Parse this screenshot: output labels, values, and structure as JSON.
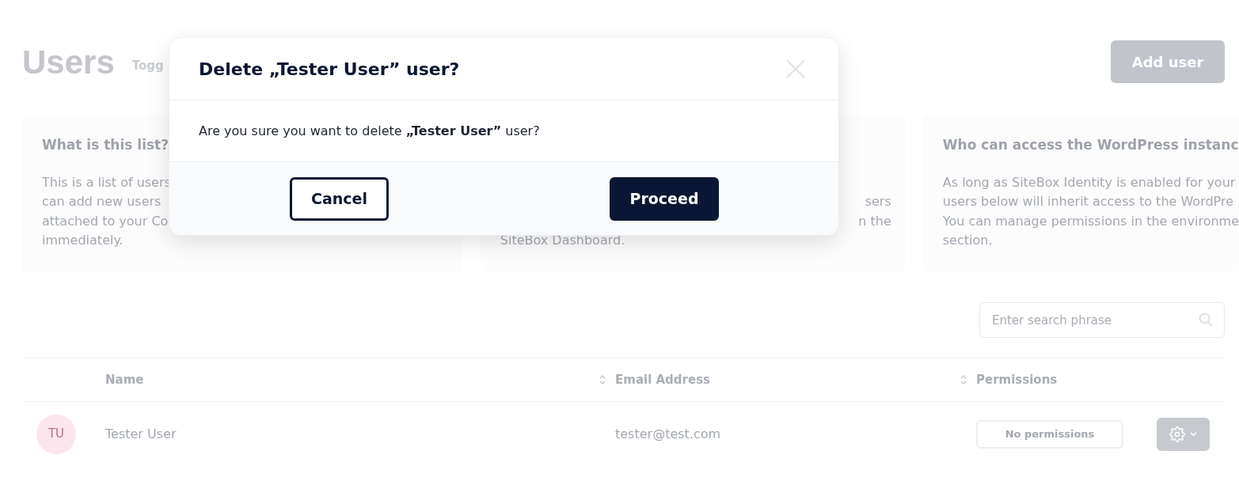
{
  "header": {
    "title": "Users",
    "toggle_label": "Togg",
    "add_button": "Add user"
  },
  "info_cards": [
    {
      "kind": "left",
      "heading": "What is this list?",
      "lines": [
        "This is a list of users",
        "can add new users",
        "attached to your Co",
        "immediately."
      ]
    },
    {
      "kind": "middle",
      "lines": [
        "sers",
        "n the",
        "SiteBox Dashboard."
      ]
    },
    {
      "kind": "right",
      "heading": "Who can access the WordPress instanc",
      "lines": [
        "As long as SiteBox Identity is enabled for your",
        "users below will inherit access to the WordPre",
        "You can manage permissions in the environme",
        "section."
      ]
    }
  ],
  "search": {
    "placeholder": "Enter search phrase"
  },
  "table": {
    "columns": [
      {
        "label": "Name",
        "sortable": true
      },
      {
        "label": "Email Address",
        "sortable": true
      },
      {
        "label": "Permissions",
        "sortable": false
      }
    ],
    "rows": [
      {
        "initials": "TU",
        "name": "Tester User",
        "email": "tester@test.com",
        "permissions": "No permissions"
      }
    ]
  },
  "dialog": {
    "title": "Delete „Tester User” user?",
    "message": "Are you sure you want to delete **„Tester User”** user?",
    "cancel": "Cancel",
    "proceed": "Proceed"
  }
}
